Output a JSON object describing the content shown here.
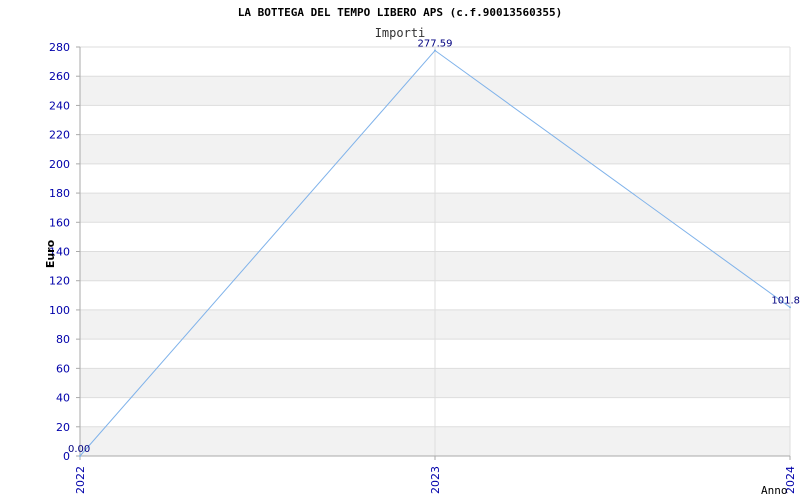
{
  "chart_data": {
    "type": "line",
    "title": "LA BOTTEGA DEL TEMPO LIBERO APS (c.f.90013560355)",
    "subtitle": "Importi",
    "xlabel": "Anno",
    "ylabel": "Euro",
    "categories": [
      "2022",
      "2023",
      "2024"
    ],
    "series": [
      {
        "values": [
          0.0,
          277.59,
          101.8
        ],
        "labels": [
          "0.00",
          "277.59",
          "101.8"
        ]
      }
    ],
    "ylim": [
      0,
      280
    ],
    "yticks": [
      0,
      20,
      40,
      60,
      80,
      100,
      120,
      140,
      160,
      180,
      200,
      220,
      240,
      260,
      280
    ],
    "grid": true,
    "colors": {
      "line": "#7fb2ea",
      "tick_text": "#0000aa",
      "label_text": "#000080",
      "band": "#f2f2f2",
      "grid": "#dddddd"
    }
  }
}
